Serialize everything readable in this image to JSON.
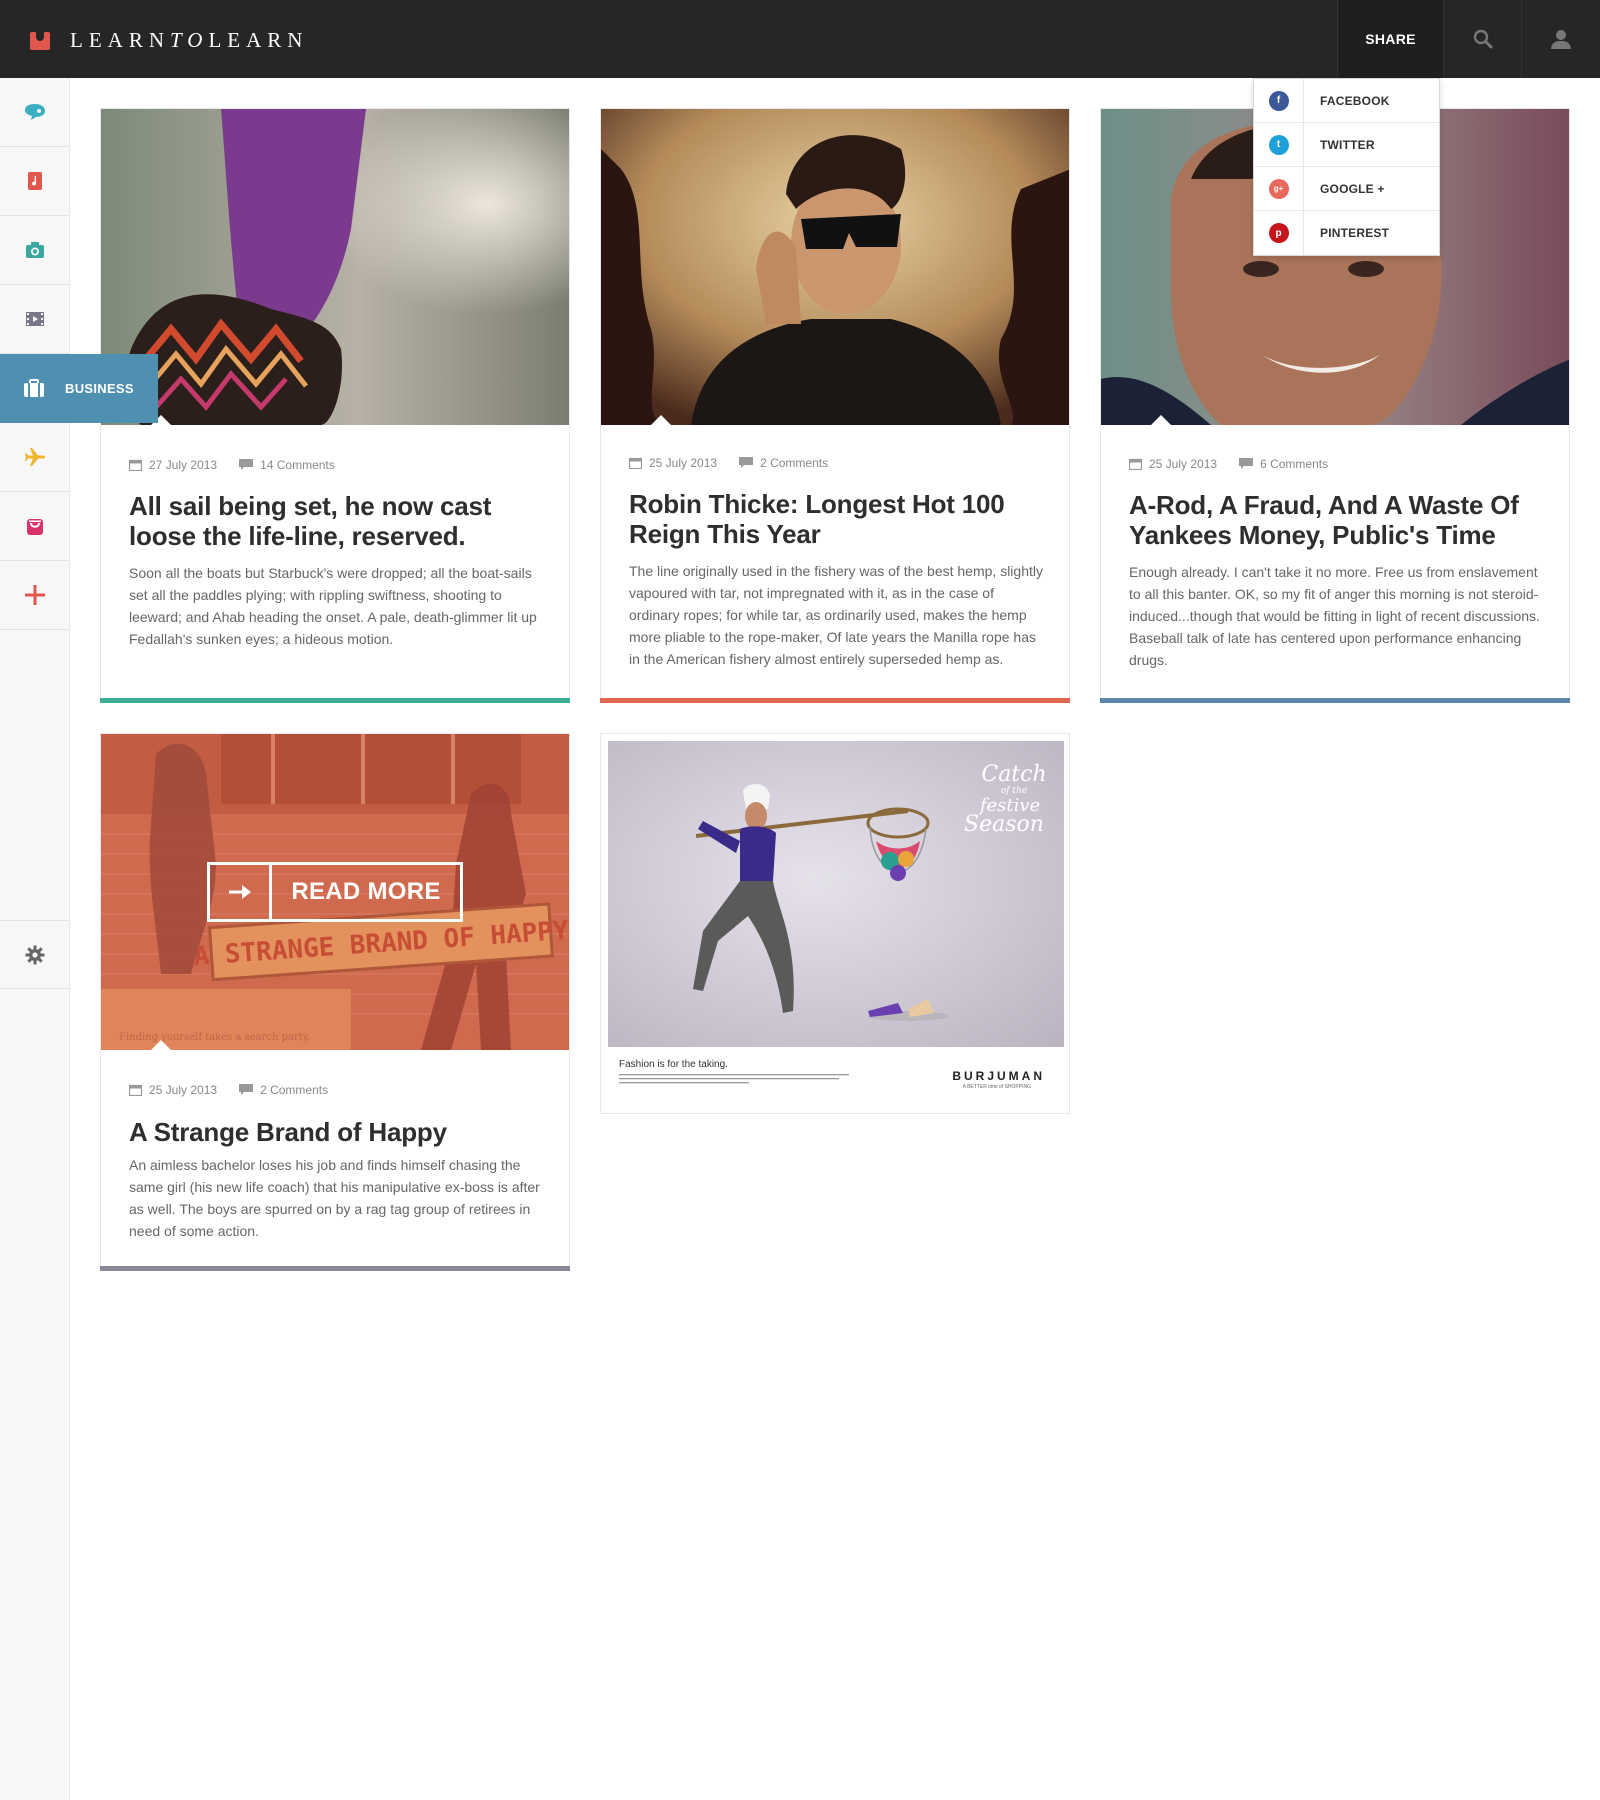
{
  "header": {
    "logo_text_a": "LEARN",
    "logo_text_b": "TO",
    "logo_text_c": "LEARN",
    "share_label": "SHARE",
    "search_icon": "search-icon",
    "user_icon": "user-icon",
    "brand_color": "#e2574c"
  },
  "share_menu": {
    "items": [
      {
        "label": "FACEBOOK",
        "icon": "facebook-icon",
        "glyph": "f",
        "color": "#3b5998"
      },
      {
        "label": "TWITTER",
        "icon": "twitter-icon",
        "glyph": "t",
        "color": "#1da1d8"
      },
      {
        "label": "GOOGLE +",
        "icon": "google-plus-icon",
        "glyph": "g+",
        "color": "#e8685e"
      },
      {
        "label": "PINTEREST",
        "icon": "pinterest-icon",
        "glyph": "p",
        "color": "#c4161c"
      }
    ]
  },
  "sidebar": {
    "items": [
      {
        "icon": "chat-icon",
        "color": "#3ab0c2"
      },
      {
        "icon": "music-icon",
        "color": "#e2574c"
      },
      {
        "icon": "camera-icon",
        "color": "#3aa8a0"
      },
      {
        "icon": "film-icon",
        "color": "#777788"
      },
      {
        "icon": "briefcase-icon",
        "label": "BUSINESS",
        "color": "#4f8fb0",
        "active": true
      },
      {
        "icon": "plane-icon",
        "color": "#f0b429"
      },
      {
        "icon": "shopping-bag-icon",
        "color": "#d9336b"
      },
      {
        "icon": "plus-icon",
        "color": "#e2574c"
      }
    ],
    "settings_icon": "gear-icon"
  },
  "posts": [
    {
      "date": "27 July 2013",
      "comments": "14 Comments",
      "title": "All sail being set, he now cast loose the life-line, reserved.",
      "excerpt": "Soon all the boats but Starbuck's were dropped; all the boat-sails set all the paddles plying; with rippling swiftness, shooting to leeward; and Ahab heading the onset. A pale, death-glimmer lit up Fedallah's sunken eyes; a hideous motion.",
      "accent": "#3aaf96"
    },
    {
      "date": "25 July 2013",
      "comments": "2 Comments",
      "title": "Robin Thicke: Longest Hot 100 Reign This Year",
      "excerpt": "The line originally used in the fishery was of the best hemp, slightly vapoured with tar, not impregnated with it, as in the case of ordinary ropes; for while tar, as ordinarily used, makes the hemp more pliable to the rope-maker, Of late years the Manilla rope has in the American fishery almost entirely superseded hemp as.",
      "accent": "#e2674f"
    },
    {
      "date": "25 July 2013",
      "comments": "6 Comments",
      "title": "A-Rod, A Fraud, And A Waste Of Yankees Money, Public's Time",
      "excerpt": "Enough already.  I can't take it no more.  Free us from enslavement to all this banter. OK, so my fit of anger this morning is not steroid-induced...though that would be fitting in light of recent discussions. Baseball talk of late has centered upon performance enhancing drugs.",
      "accent": "#5b87ad"
    },
    {
      "date": "25 July 2013",
      "comments": "2 Comments",
      "title": "A Strange Brand of Happy",
      "excerpt": "An aimless bachelor loses his job and finds himself chasing the same girl (his new life coach) that his manipulative ex-boss is after as well. The boys are spurred on by a rag tag group of retirees in need of some action.",
      "accent": "#8a8799",
      "read_more": "READ MORE",
      "poster_text": "A STRANGE BRAND OF HAPPY",
      "poster_tagline": "Finding yourself takes a search party."
    }
  ],
  "ad": {
    "script_1": "Catch",
    "script_2": "of the",
    "script_3": "festive",
    "script_4": "Season",
    "caption": "Fashion is for the taking.",
    "brand": "BURJUMAN",
    "brand_sub": "A BETTER time of SHOPPING"
  }
}
